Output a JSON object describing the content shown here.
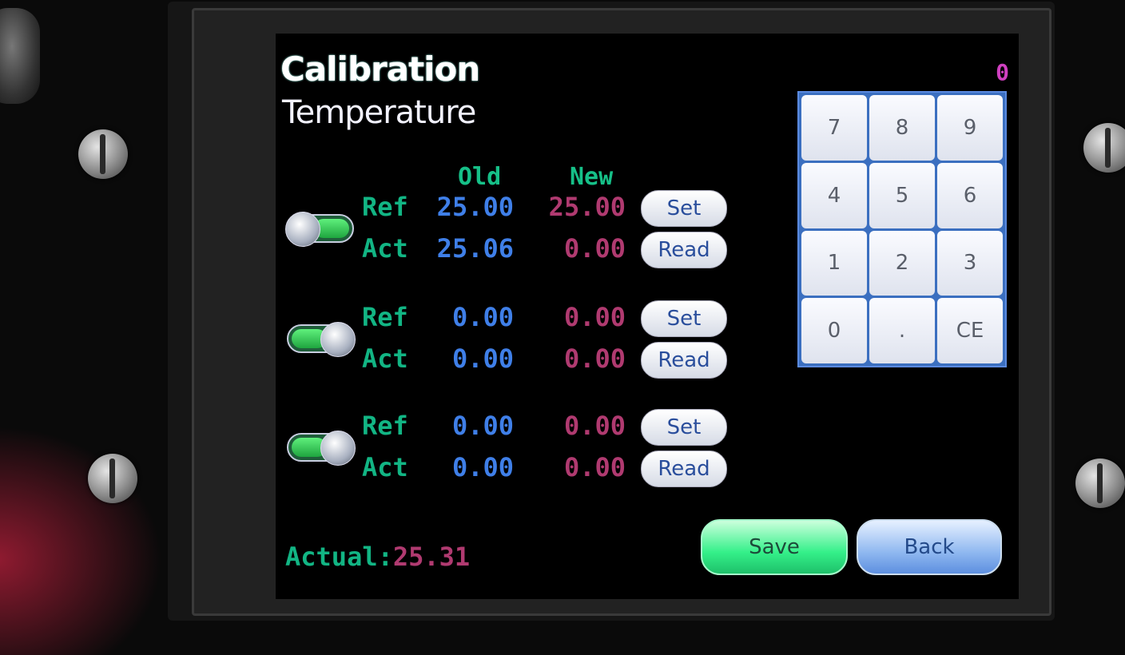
{
  "header": {
    "title": "Calibration",
    "subtitle": "Temperature",
    "entry_value": "0"
  },
  "columns": {
    "old": "Old",
    "new": "New"
  },
  "channels": [
    {
      "toggle_state": "on",
      "ref": {
        "label": "Ref",
        "old": "25.00",
        "new": "25.00",
        "button": "Set"
      },
      "act": {
        "label": "Act",
        "old": "25.06",
        "new": "0.00",
        "button": "Read"
      }
    },
    {
      "toggle_state": "off",
      "ref": {
        "label": "Ref",
        "old": "0.00",
        "new": "0.00",
        "button": "Set"
      },
      "act": {
        "label": "Act",
        "old": "0.00",
        "new": "0.00",
        "button": "Read"
      }
    },
    {
      "toggle_state": "off",
      "ref": {
        "label": "Ref",
        "old": "0.00",
        "new": "0.00",
        "button": "Set"
      },
      "act": {
        "label": "Act",
        "old": "0.00",
        "new": "0.00",
        "button": "Read"
      }
    }
  ],
  "keypad": {
    "keys": [
      "7",
      "8",
      "9",
      "4",
      "5",
      "6",
      "1",
      "2",
      "3",
      "0",
      ".",
      "CE"
    ]
  },
  "footer": {
    "actual_label": "Actual:",
    "actual_value": "25.31",
    "save_label": "Save",
    "back_label": "Back"
  },
  "colors": {
    "label_green": "#12b584",
    "old_blue": "#3f7fe8",
    "new_red": "#b03a70",
    "counter_magenta": "#d040c0"
  }
}
